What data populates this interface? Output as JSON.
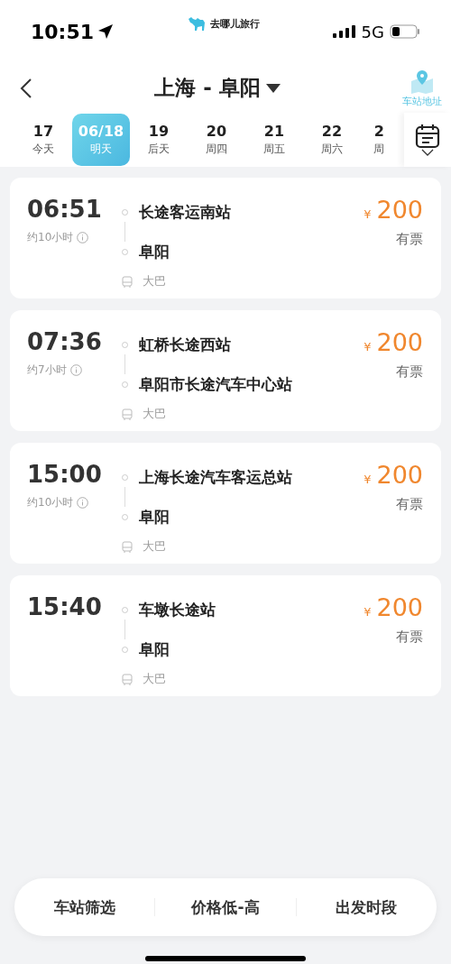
{
  "status_bar": {
    "time": "10:51",
    "app_name": "去哪儿旅行",
    "network": "5G"
  },
  "header": {
    "title": "上海 - 阜阳",
    "station_link": "车站地址"
  },
  "dates": [
    {
      "day": "17",
      "label": "今天",
      "selected": false
    },
    {
      "day": "06/18",
      "label": "明天",
      "selected": true
    },
    {
      "day": "19",
      "label": "后天",
      "selected": false
    },
    {
      "day": "20",
      "label": "周四",
      "selected": false
    },
    {
      "day": "21",
      "label": "周五",
      "selected": false
    },
    {
      "day": "22",
      "label": "周六",
      "selected": false
    },
    {
      "day": "2",
      "label": "周",
      "selected": false
    }
  ],
  "trips": [
    {
      "time": "06:51",
      "duration": "约10小时",
      "from": "长途客运南站",
      "to": "阜阳",
      "vehicle": "大巴",
      "currency": "¥",
      "price": "200",
      "availability": "有票"
    },
    {
      "time": "07:36",
      "duration": "约7小时",
      "from": "虹桥长途西站",
      "to": "阜阳市长途汽车中心站",
      "vehicle": "大巴",
      "currency": "¥",
      "price": "200",
      "availability": "有票"
    },
    {
      "time": "15:00",
      "duration": "约10小时",
      "from": "上海长途汽车客运总站",
      "to": "阜阳",
      "vehicle": "大巴",
      "currency": "¥",
      "price": "200",
      "availability": "有票"
    },
    {
      "time": "15:40",
      "from": "车墩长途站",
      "to": "阜阳",
      "vehicle": "大巴",
      "currency": "¥",
      "price": "200",
      "availability": "有票"
    }
  ],
  "bottom_bar": [
    "车站筛选",
    "价格低-高",
    "出发时段"
  ]
}
